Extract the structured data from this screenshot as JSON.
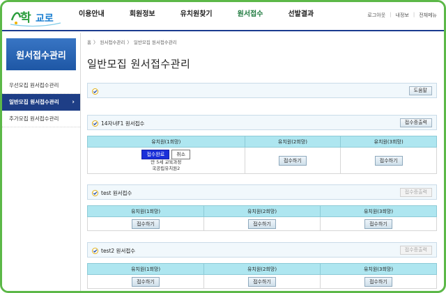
{
  "header": {
    "logo_text": "처음학교로",
    "nav": [
      "이용안내",
      "회원정보",
      "유치원찾기",
      "원서접수",
      "선발결과"
    ],
    "active_nav": "원서접수",
    "util": [
      "로그아웃",
      "내정보",
      "전체메뉴"
    ]
  },
  "sidebar": {
    "title": "원서접수관리",
    "items": [
      {
        "label": "우선모집 원서접수관리"
      },
      {
        "label": "일반모집 원서접수관리",
        "arrow": "›"
      },
      {
        "label": "추가모집 원서접수관리"
      }
    ]
  },
  "breadcrumb": [
    "홈",
    "〉",
    "원서접수관리",
    "〉",
    "일반모집 원서접수관리"
  ],
  "page_title": "일반모집 원서접수관리",
  "help_box": {
    "help_button": "도움말"
  },
  "sections": [
    {
      "title": "14자녀F1 원서접수",
      "print_button": "접수증출력",
      "print_enabled": true,
      "headers": [
        "유치원(1희망)",
        "유치원(2희망)",
        "유치원(3희망)"
      ],
      "first_cell": {
        "done_label": "접수완료",
        "cancel_label": "취소",
        "line1": "만 5세 교육과정",
        "line2": "국공립유치원2"
      },
      "apply_label": "접수하기"
    },
    {
      "title": "test 원서접수",
      "print_button": "접수증출력",
      "print_enabled": false,
      "headers": [
        "유치원(1희망)",
        "유치원(2희망)",
        "유치원(3희망)"
      ],
      "apply_label": "접수하기"
    },
    {
      "title": "test2 원서접수",
      "print_button": "접수증출력",
      "print_enabled": false,
      "headers": [
        "유치원(1희망)",
        "유치원(2희망)",
        "유치원(3희망)"
      ],
      "apply_label": "접수하기"
    }
  ],
  "colors": {
    "frame": "#5cb848",
    "nav_active": "#1f7a3f",
    "side_title": "#2c66b3",
    "side_active": "#1e3e86",
    "table_header": "#aee6f0",
    "done_button": "#1a2fd9"
  }
}
